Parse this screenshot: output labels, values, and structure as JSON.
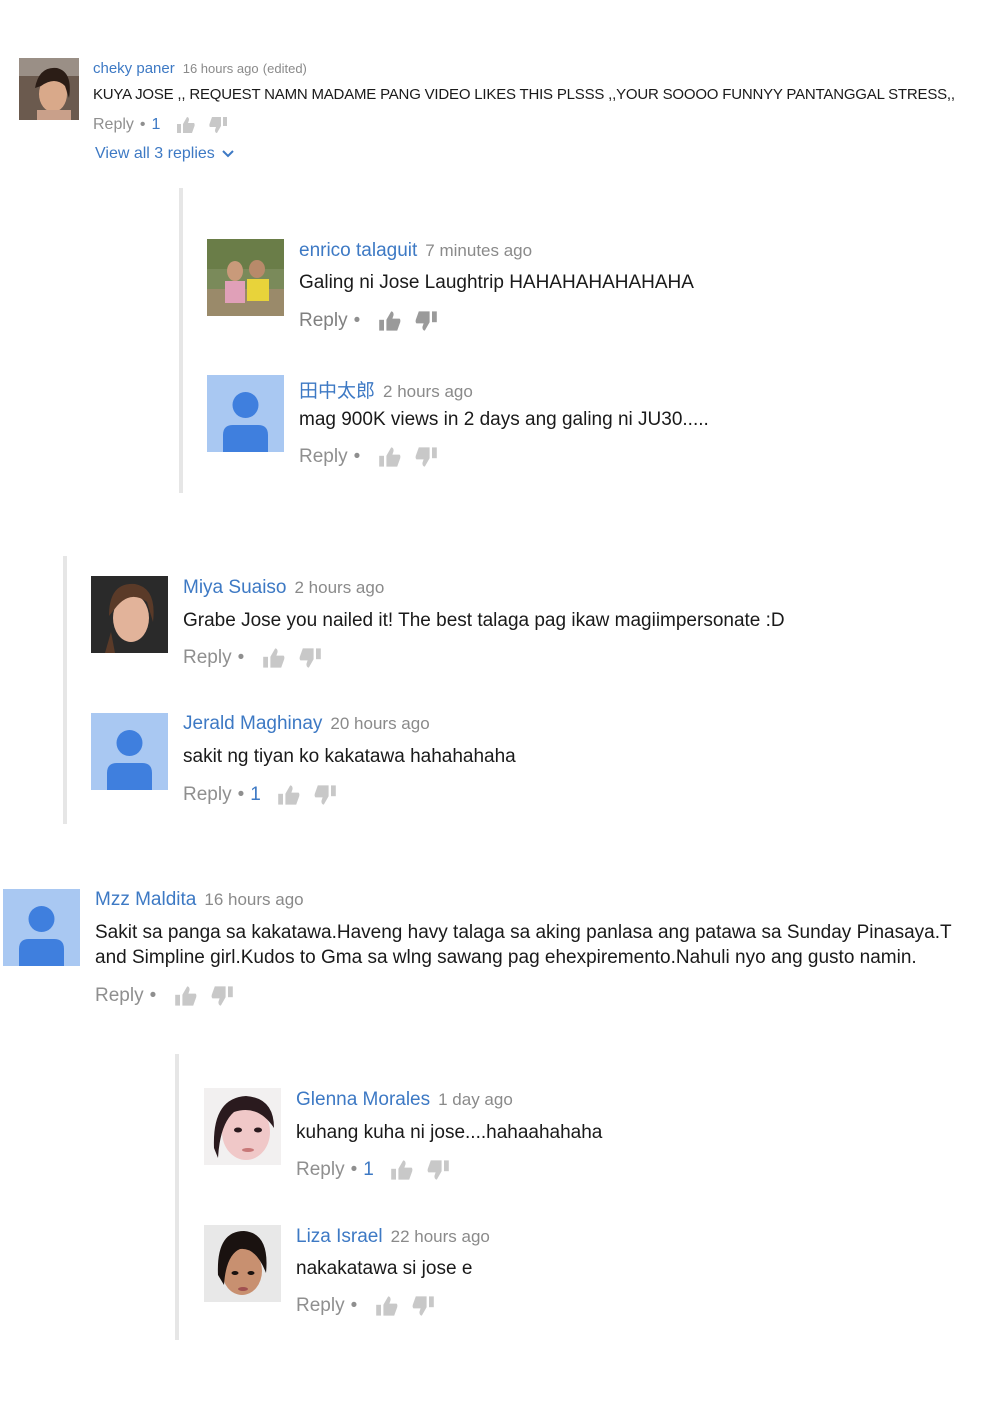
{
  "comments": [
    {
      "author": "cheky paner",
      "time": "16 hours ago",
      "edited": "(edited)",
      "text": "KUYA JOSE ,, REQUEST NAMN MADAME PANG VIDEO LIKES THIS PLSSS ,,YOUR SOOOO FUNNYY PANTANGGAL STRESS,,",
      "reply_label": "Reply",
      "likes": "1",
      "view_replies": "View all 3 replies"
    },
    {
      "author": "enrico talaguit",
      "time": "7 minutes ago",
      "text": "Galing ni Jose Laughtrip HAHAHAHAHAHAHA",
      "reply_label": "Reply"
    },
    {
      "author": "田中太郎",
      "time": "2 hours ago",
      "text": "mag 900K views in 2  days ang galing ni JU30.....",
      "reply_label": "Reply"
    },
    {
      "author": "Miya Suaiso",
      "time": "2 hours ago",
      "text": "Grabe Jose you nailed it! The best talaga pag ikaw magiimpersonate :D",
      "reply_label": "Reply"
    },
    {
      "author": "Jerald Maghinay",
      "time": "20 hours ago",
      "text": "sakit ng tiyan ko kakatawa hahahahaha",
      "reply_label": "Reply",
      "likes": "1"
    },
    {
      "author": "Mzz Maldita",
      "time": "16 hours ago",
      "text_line1": "Sakit sa panga sa kakatawa.Haveng havy talaga sa aking panlasa ang patawa sa Sunday Pinasaya.T",
      "text_line2": "and Simpline girl.Kudos to Gma sa wlng sawang pag ehexpiremento.Nahuli nyo ang gusto namin.",
      "reply_label": "Reply"
    },
    {
      "author": "Glenna Morales",
      "time": "1 day ago",
      "text": "kuhang kuha ni jose....hahaahahaha",
      "reply_label": "Reply",
      "likes": "1"
    },
    {
      "author": "Liza Israel",
      "time": "22 hours ago",
      "text": "nakakatawa si jose e",
      "reply_label": "Reply"
    }
  ],
  "icons": {
    "like": "thumbs-up-icon",
    "dislike": "thumbs-down-icon",
    "expand": "chevron-down-icon",
    "default_avatar": "default-user-avatar"
  },
  "colors": {
    "author": "#3d79c4",
    "muted": "#8f8f8f",
    "default_avatar_bg": "#9ec3f0",
    "default_avatar_fg": "#3d79db"
  }
}
